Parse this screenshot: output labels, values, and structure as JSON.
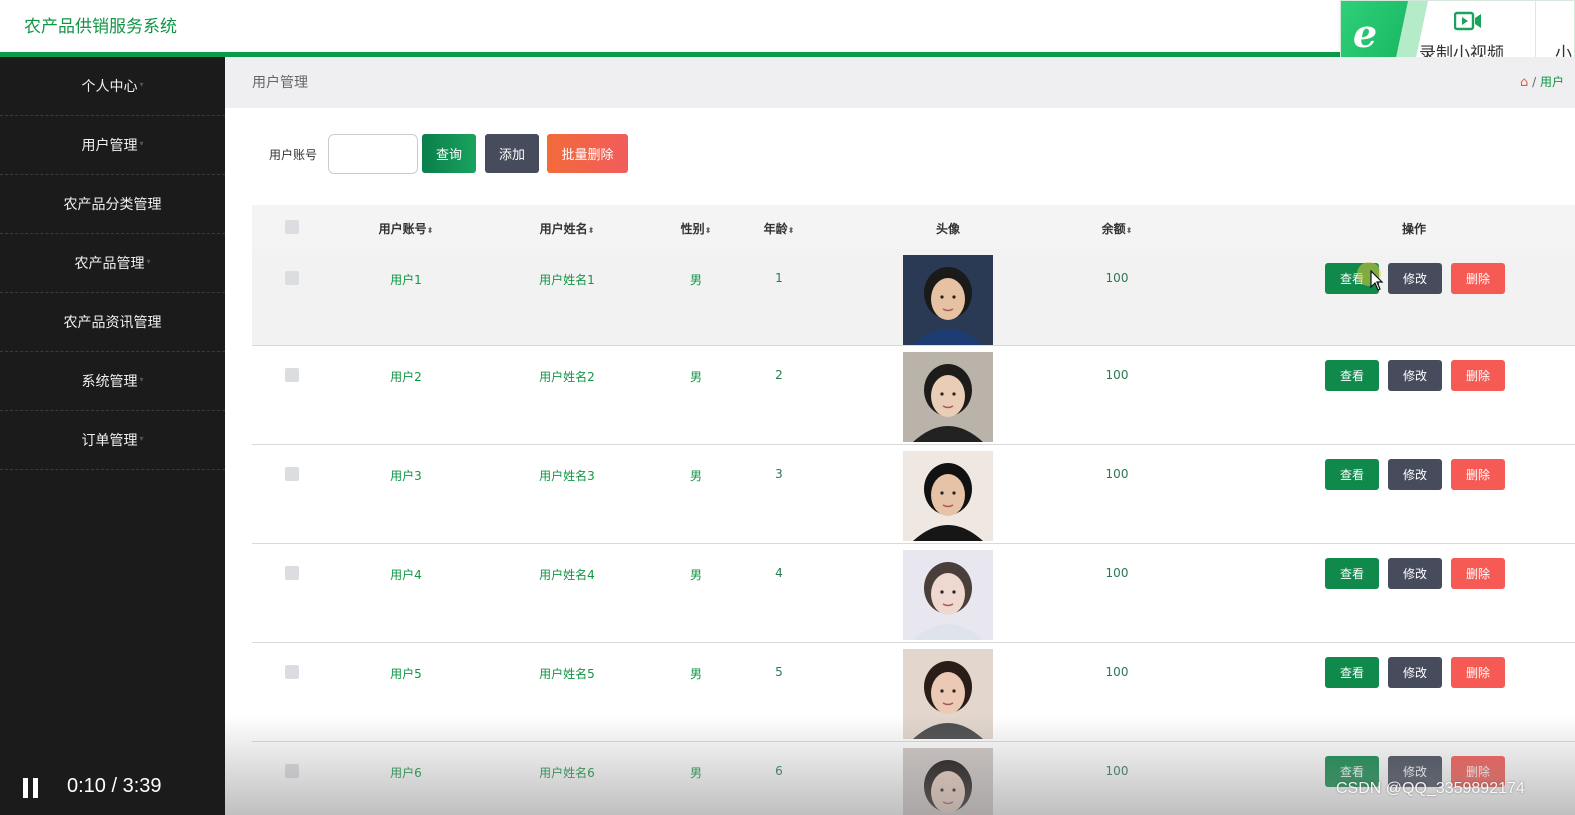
{
  "header": {
    "app_title": "农产品供销服务系统"
  },
  "recorder": {
    "label": "录制小视频",
    "more": "小"
  },
  "sidebar": {
    "items": [
      {
        "label": "个人中心",
        "caret": "▾"
      },
      {
        "label": "用户管理",
        "caret": "▾"
      },
      {
        "label": "农产品分类管理",
        "caret": ""
      },
      {
        "label": "农产品管理",
        "caret": "▾"
      },
      {
        "label": "农产品资讯管理",
        "caret": ""
      },
      {
        "label": "系统管理",
        "caret": "▾"
      },
      {
        "label": "订单管理",
        "caret": "▾"
      }
    ]
  },
  "breadcrumb": {
    "title": "用户管理",
    "sep": "/",
    "current": "用户"
  },
  "search": {
    "label": "用户账号",
    "value": "",
    "query_label": "查询",
    "add_label": "添加",
    "batch_delete_label": "批量删除"
  },
  "table": {
    "columns": {
      "account": "用户账号",
      "name": "用户姓名",
      "gender": "性别",
      "age": "年龄",
      "avatar": "头像",
      "balance": "余额",
      "actions": "操作",
      "sort_icon": "⬍"
    },
    "row_actions": {
      "view": "查看",
      "edit": "修改",
      "delete": "删除"
    },
    "rows": [
      {
        "account": "用户1",
        "name": "用户姓名1",
        "gender": "男",
        "age": "1",
        "balance": "100"
      },
      {
        "account": "用户2",
        "name": "用户姓名2",
        "gender": "男",
        "age": "2",
        "balance": "100"
      },
      {
        "account": "用户3",
        "name": "用户姓名3",
        "gender": "男",
        "age": "3",
        "balance": "100"
      },
      {
        "account": "用户4",
        "name": "用户姓名4",
        "gender": "男",
        "age": "4",
        "balance": "100"
      },
      {
        "account": "用户5",
        "name": "用户姓名5",
        "gender": "男",
        "age": "5",
        "balance": "100"
      },
      {
        "account": "用户6",
        "name": "用户姓名6",
        "gender": "男",
        "age": "6",
        "balance": "100"
      }
    ]
  },
  "player": {
    "time": "0:10 / 3:39"
  },
  "watermark": "CSDN @QQ_3359892174",
  "colors": {
    "brand_green": "#119545",
    "sidebar_bg": "#1b1b1b",
    "delete_red": "#f55a54",
    "edit_slate": "#464c5c"
  }
}
